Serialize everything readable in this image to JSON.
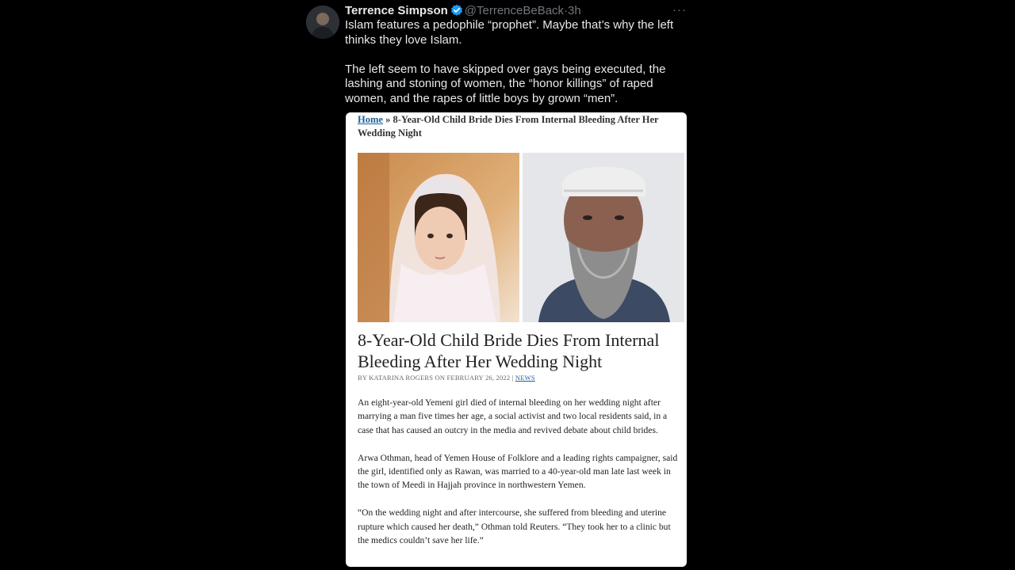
{
  "tweet": {
    "author_name": "Terrence Simpson",
    "handle": "@TerrenceBeBack",
    "separator": "·",
    "time": "3h",
    "more": "···",
    "paragraphs": [
      "Islam features a pedophile “prophet”. Maybe that’s why the left thinks they love Islam.",
      "The left seem to have skipped over gays being executed, the lashing and stoning of women, the “honor killings” of raped women, and the rapes of little boys by grown “men”."
    ]
  },
  "article": {
    "breadcrumb_home": "Home",
    "breadcrumb_sep": " » ",
    "breadcrumb_current": "8-Year-Old Child Bride Dies From Internal Bleeding After Her Wedding Night",
    "headline": "8-Year-Old Child Bride Dies From Internal Bleeding After Her Wedding Night",
    "byline": "BY KATARINA ROGERS ON FEBRUARY 26, 2022 | ",
    "category": "NEWS",
    "paragraphs": [
      "An eight-year-old Yemeni girl died of internal bleeding on her wedding night after marrying a man five times her age, a social activist and two local residents said, in a case that has caused an outcry in the media and revived debate about child brides.",
      "Arwa Othman, head of Yemen House of Folklore and a leading rights campaigner, said the girl, identified only as Rawan, was married to a 40-year-old man late last week in the town of Meedi in Hajjah province in northwestern Yemen.",
      "“On the wedding night and after intercourse, she suffered from bleeding and uterine rupture which caused her death,” Othman told Reuters. “They took her to a clinic but the medics couldn’t save her life.”"
    ]
  },
  "colors": {
    "background": "#000000",
    "text": "#e7e9ea",
    "muted": "#71767b",
    "verified": "#1d9bf0",
    "link": "#1f5f99"
  }
}
